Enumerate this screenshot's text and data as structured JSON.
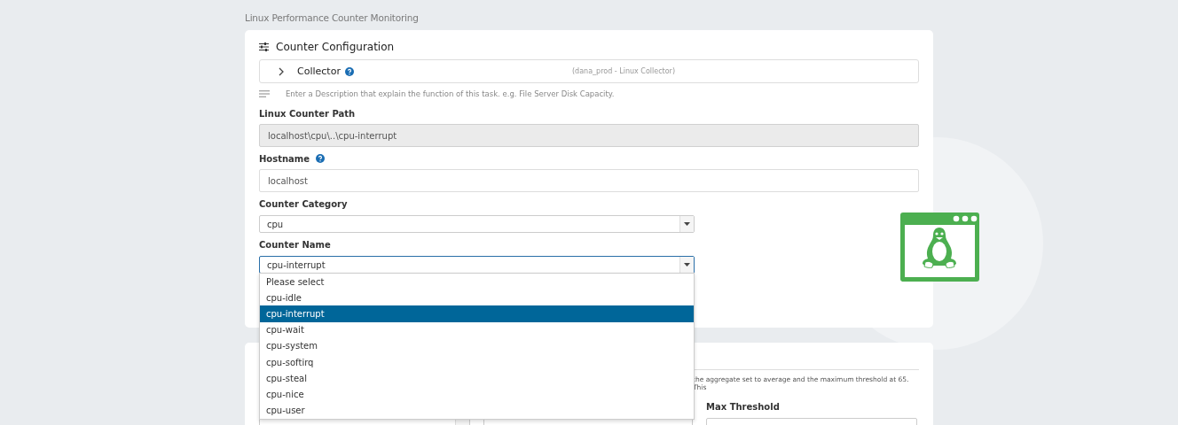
{
  "page_title": "Linux Performance Counter Monitoring",
  "config_card": {
    "title": "Counter Configuration",
    "collector": {
      "label": "Collector",
      "expanded": false,
      "value": "(dana_prod - Linux Collector)"
    },
    "description_placeholder": "Enter a Description that explain the function of this task. e.g. File Server Disk Capacity.",
    "fields": [
      {
        "kind": "text",
        "label": "Linux Counter Path",
        "value": "localhost\\cpu\\..\\cpu-interrupt",
        "disabled": true,
        "help": false
      },
      {
        "kind": "text",
        "label": "Hostname",
        "value": "localhost",
        "disabled": false,
        "help": true
      },
      {
        "kind": "select",
        "label": "Counter Category",
        "value": "cpu",
        "open": false
      },
      {
        "kind": "select",
        "label": "Counter Name",
        "value": "cpu-interrupt",
        "open": true,
        "options": [
          {
            "label": "Please select",
            "selected": false
          },
          {
            "label": "cpu-idle",
            "selected": false
          },
          {
            "label": "cpu-interrupt",
            "selected": true
          },
          {
            "label": "cpu-wait",
            "selected": false
          },
          {
            "label": "cpu-system",
            "selected": false
          },
          {
            "label": "cpu-softirq",
            "selected": false
          },
          {
            "label": "cpu-steal",
            "selected": false
          },
          {
            "label": "cpu-nice",
            "selected": false
          },
          {
            "label": "cpu-user",
            "selected": false
          }
        ]
      }
    ]
  },
  "threshold_card": {
    "description": "the aggregate set to average and the maximum threshold at 65. This",
    "fields": [
      {
        "kind": "select"
      },
      {
        "kind": "text"
      },
      {
        "kind": "text",
        "label": "Max Threshold"
      }
    ]
  }
}
